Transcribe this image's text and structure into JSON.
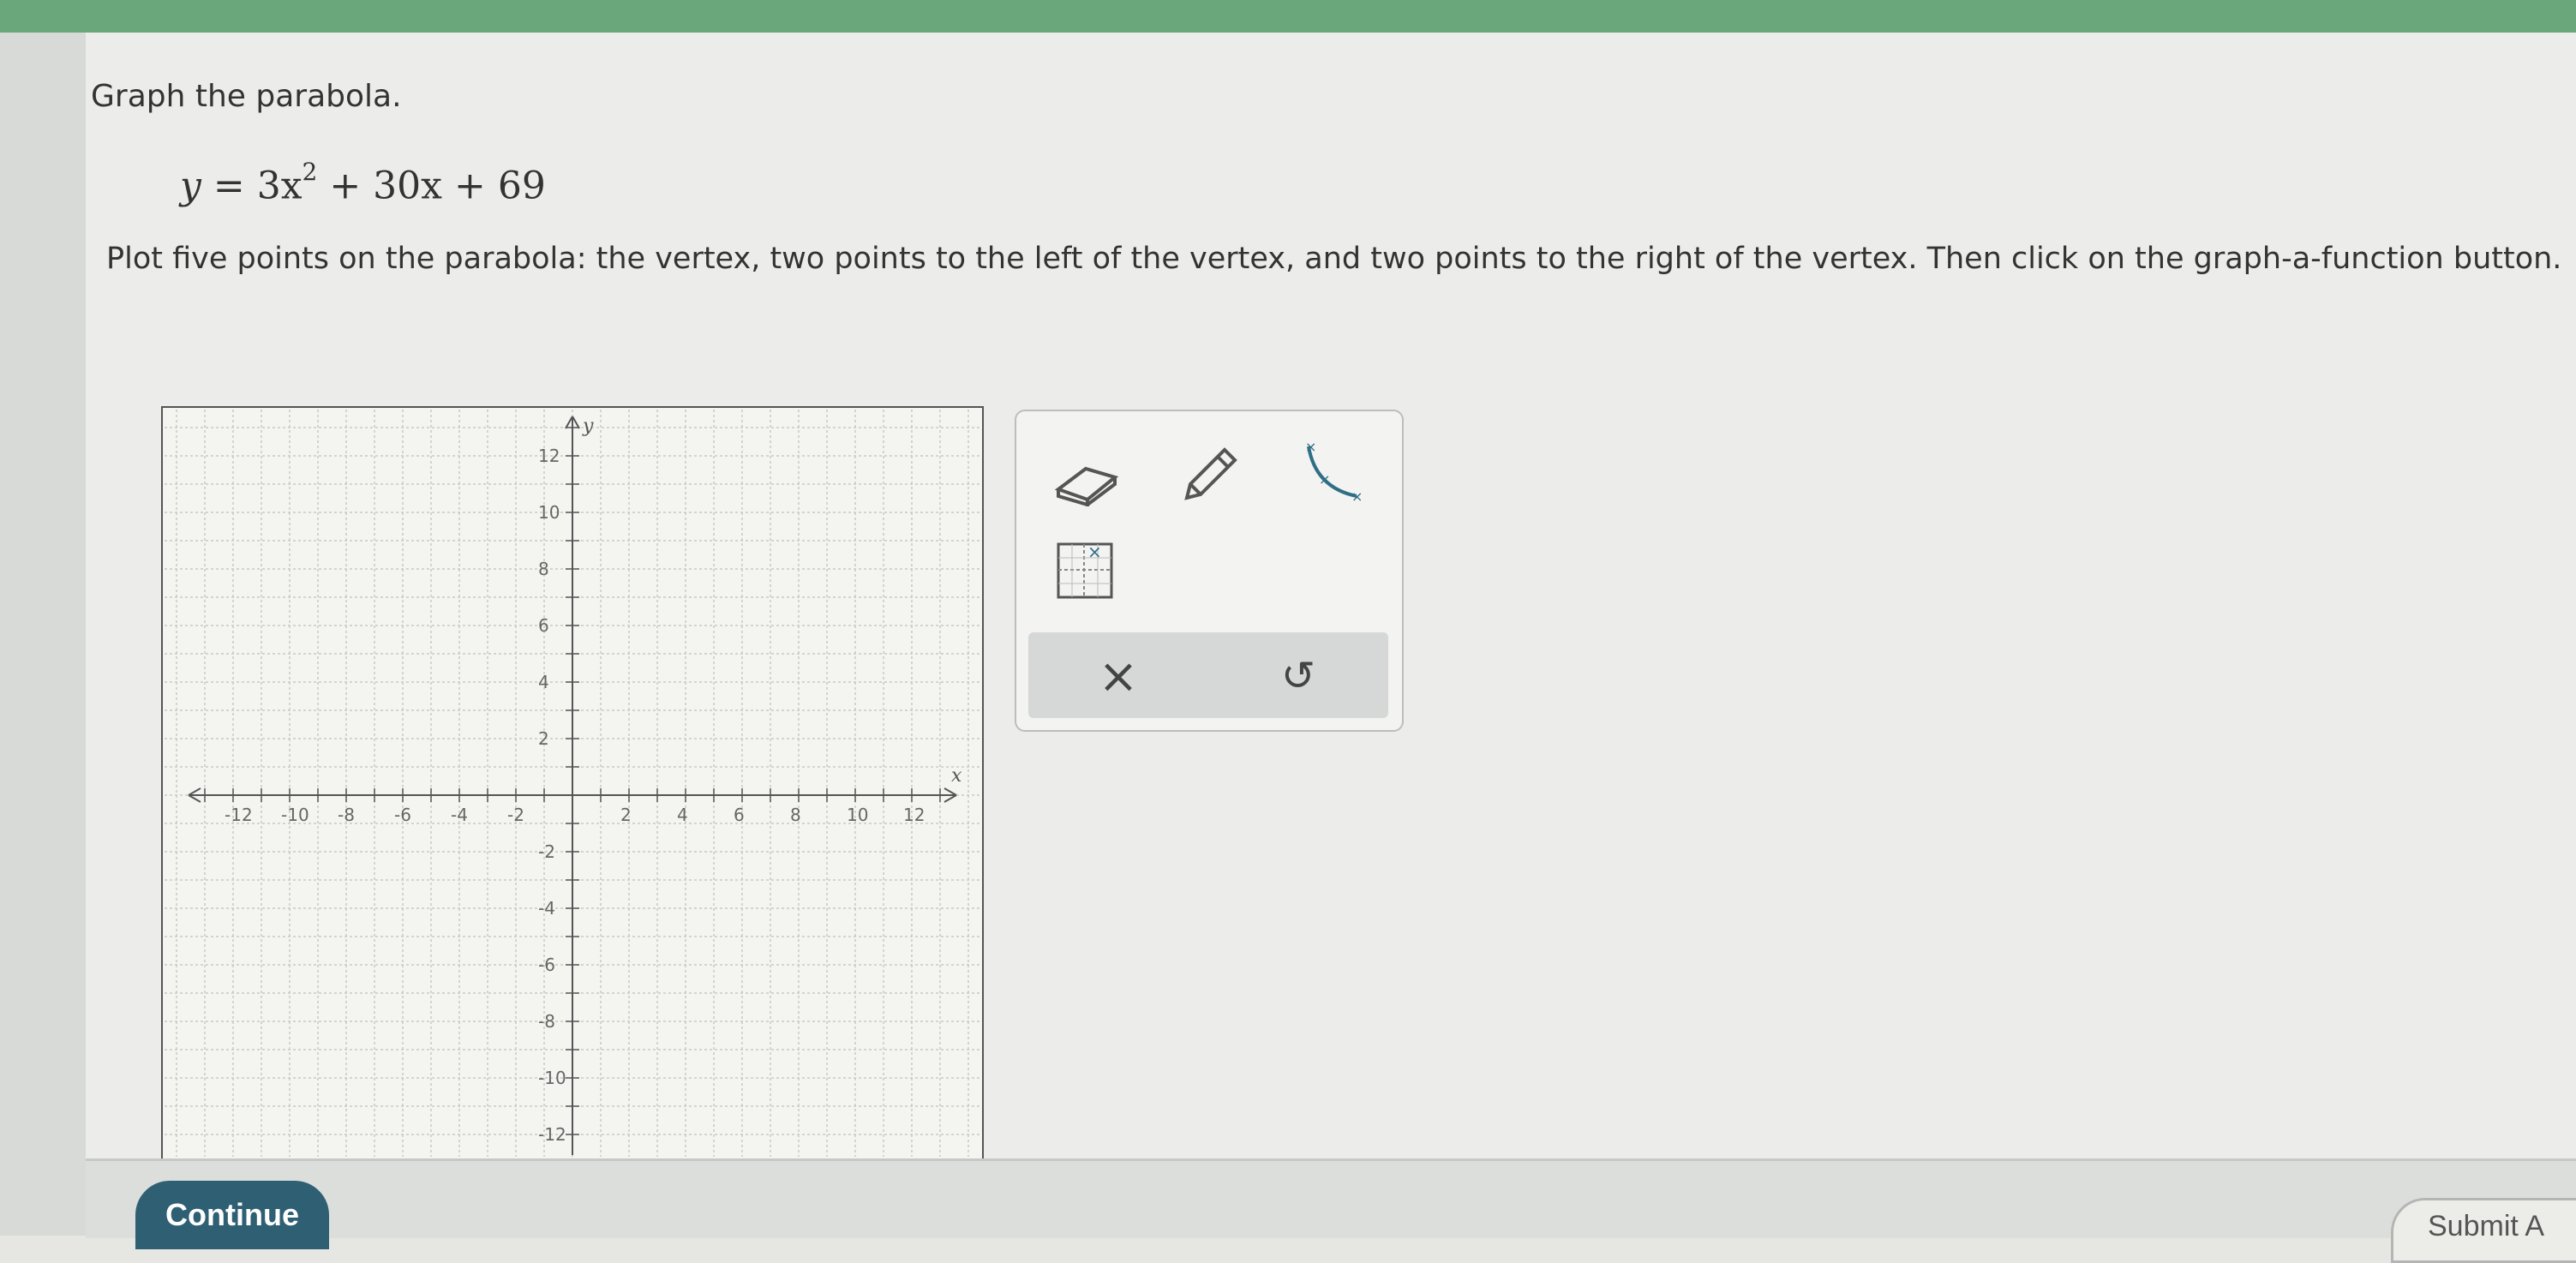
{
  "problem": {
    "title": "Graph the parabola.",
    "equation_lhs": "y",
    "equation_eq": " = ",
    "equation_coef": "3x",
    "equation_exp": "2",
    "equation_rest": " + 30x + 69",
    "instructions": "Plot five points on the parabola: the vertex, two points to the left of the vertex, and two points to the right of the vertex. Then click on the graph-a-function button."
  },
  "graph": {
    "x_axis_label": "x",
    "y_axis_label": "y",
    "x_ticks": [
      "-12",
      "-10",
      "-8",
      "-6",
      "-4",
      "-2",
      "2",
      "4",
      "6",
      "8",
      "10",
      "12"
    ],
    "y_ticks_pos": [
      "12",
      "10",
      "8",
      "6",
      "4",
      "2"
    ],
    "y_ticks_neg": [
      "-2",
      "-4",
      "-6",
      "-8",
      "-10",
      "-12"
    ]
  },
  "toolbox": {
    "tools": [
      "eraser-icon",
      "pencil-icon",
      "graph-function-icon",
      "point-grid-icon"
    ],
    "actions": [
      "clear-icon",
      "undo-icon"
    ],
    "clear_glyph": "×",
    "undo_glyph": "↺"
  },
  "footer": {
    "continue_label": "Continue",
    "submit_label": "Submit A"
  },
  "colors": {
    "topbar": "#6aa77b",
    "button": "#2e5f73",
    "tool_accent": "#2f6f86"
  }
}
